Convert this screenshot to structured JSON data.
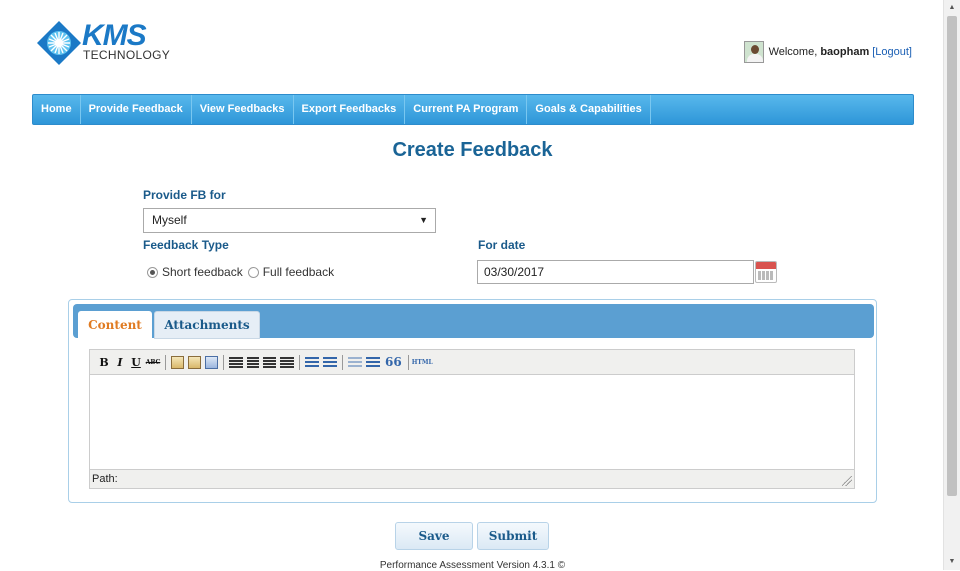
{
  "header": {
    "logo_text": "KMS",
    "logo_sub": "TECHNOLOGY",
    "welcome_prefix": "Welcome, ",
    "username": "baopham",
    "logout_label": "[Logout]"
  },
  "nav": {
    "items": [
      "Home",
      "Provide Feedback",
      "View Feedbacks",
      "Export Feedbacks",
      "Current PA Program",
      "Goals & Capabilities"
    ]
  },
  "page": {
    "title": "Create Feedback"
  },
  "form": {
    "provide_for_label": "Provide FB for",
    "provide_for_value": "Myself",
    "feedback_type_label": "Feedback Type",
    "short_feedback_label": "Short feedback",
    "full_feedback_label": "Full feedback",
    "selected_type": "Short feedback",
    "for_date_label": "For date",
    "for_date_value": "03/30/2017"
  },
  "tabs": {
    "content_label": "Content",
    "attachments_label": "Attachments",
    "active": "Content"
  },
  "editor": {
    "bold": "B",
    "italic": "I",
    "underline": "U",
    "strike": "ABC",
    "html": "HTML",
    "quote": "66",
    "path_label": "Path:"
  },
  "actions": {
    "save_label": "Save",
    "submit_label": "Submit"
  },
  "footer": {
    "version_text": "Performance Assessment Version 4.3.1 ©"
  },
  "colors": {
    "nav_bar": "#2e96d8",
    "title": "#1a6496",
    "active_tab_text": "#e07b22",
    "tab_bar": "#5b9fd2"
  }
}
